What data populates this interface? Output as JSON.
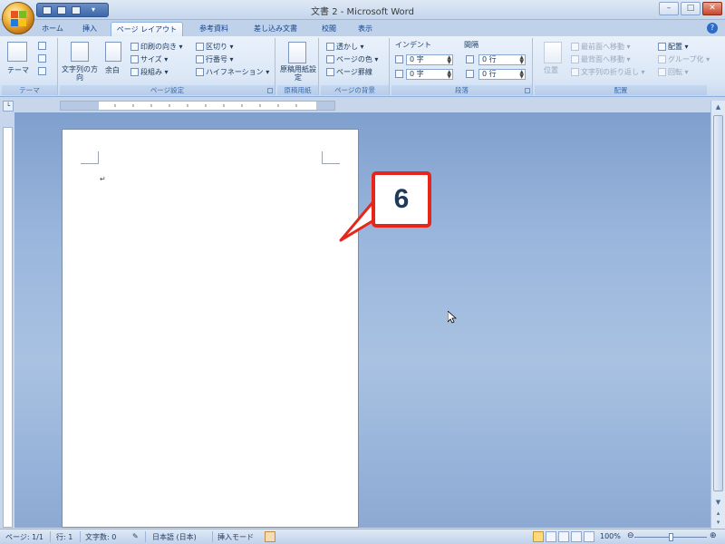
{
  "window": {
    "title": "文書 2 - Microsoft Word",
    "minimize": "–",
    "maximize": "□",
    "close": "✕"
  },
  "tabs": [
    {
      "label": "ホーム"
    },
    {
      "label": "挿入"
    },
    {
      "label": "ページ レイアウト"
    },
    {
      "label": "参考資料"
    },
    {
      "label": "差し込み文書"
    },
    {
      "label": "校閲"
    },
    {
      "label": "表示"
    }
  ],
  "active_tab": "ページ レイアウト",
  "ribbon": {
    "themes": {
      "label": "テーマ",
      "theme_button": "テーマ"
    },
    "page_setup": {
      "label": "ページ設定",
      "text_direction": "文字列の方向",
      "margins": "余白",
      "orientation": "印刷の向き",
      "size": "サイズ",
      "columns": "段組み",
      "breaks": "区切り",
      "line_numbers": "行番号",
      "hyphenation": "ハイフネーション"
    },
    "manuscript": {
      "label": "原稿用紙",
      "button": "原稿用紙設定"
    },
    "page_background": {
      "label": "ページの背景",
      "watermark": "透かし",
      "page_color": "ページの色",
      "page_borders": "ページ罫線"
    },
    "paragraph": {
      "label": "段落",
      "indent_title": "インデント",
      "spacing_title": "間隔",
      "indent_left": "0 字",
      "indent_right": "0 字",
      "spacing_before": "0 行",
      "spacing_after": "0 行"
    },
    "arrange": {
      "label": "配置",
      "position": "位置",
      "bring_front": "最前面へ移動",
      "send_back": "最背面へ移動",
      "text_wrap": "文字列の折り返し",
      "align": "配置",
      "group": "グループ化",
      "rotate": "回転"
    }
  },
  "callout": {
    "number": "6"
  },
  "status_bar": {
    "page": "ページ: 1/1",
    "line": "行: 1",
    "word_count": "文字数: 0",
    "language": "日本語 (日本)",
    "mode": "挿入モード",
    "zoom": "100%"
  }
}
